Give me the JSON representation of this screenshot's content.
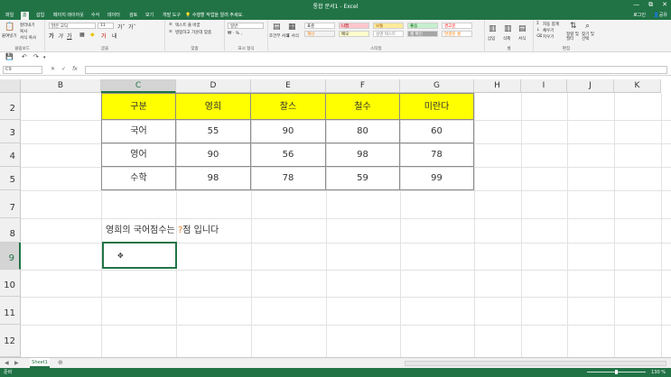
{
  "window": {
    "title": "통합 문서1 - Excel",
    "controls": [
      "—",
      "⧉",
      "✕"
    ]
  },
  "tabs": {
    "items": [
      "파일",
      "홈",
      "삽입",
      "페이지 레이아웃",
      "수식",
      "데이터",
      "검토",
      "보기",
      "개발 도구"
    ],
    "active": "홈",
    "tell_me": "수행할 작업을 알려 주세요.",
    "login": "로그인",
    "share": "공유"
  },
  "ribbon": {
    "clipboard_label": "클립보드",
    "paste": "붙여넣기",
    "cut": "잘라내기",
    "copy": "복사",
    "format_painter": "서식 복사",
    "font_label": "글꼴",
    "font_name": "맑은 고딕",
    "font_size": "11",
    "align_label": "맞춤",
    "wrap_text": "텍스트 줄 바꿈",
    "merge_center": "병합하고 가운데 맞춤",
    "number_label": "표시 형식",
    "number_format": "일반",
    "conditional": "조건부 서식",
    "table_format": "표 서식",
    "styles_label": "스타일",
    "styles": [
      {
        "label": "표준",
        "bg": "#ffffff",
        "color": "#222222"
      },
      {
        "label": "나쁨",
        "bg": "#ffc7ce",
        "color": "#9c0006"
      },
      {
        "label": "보통",
        "bg": "#ffeb9c",
        "color": "#9c5700"
      },
      {
        "label": "좋음",
        "bg": "#c6efce",
        "color": "#006100"
      },
      {
        "label": "경고문",
        "bg": "#ffffff",
        "color": "#ff0000"
      },
      {
        "label": "계산",
        "bg": "#f2f2f2",
        "color": "#fa7d00"
      },
      {
        "label": "메모",
        "bg": "#ffffcc",
        "color": "#222222"
      },
      {
        "label": "설명 텍스트",
        "bg": "#ffffff",
        "color": "#7f7f7f"
      },
      {
        "label": "셀 확인",
        "bg": "#a5a5a5",
        "color": "#ffffff"
      },
      {
        "label": "연결된 셀",
        "bg": "#ffffff",
        "color": "#fa7d00"
      }
    ],
    "cells_label": "셀",
    "insert": "삽입",
    "delete": "삭제",
    "format": "서식",
    "editing_label": "편집",
    "autosum": "자동 합계",
    "fill": "채우기",
    "clear": "지우기",
    "sort_filter": "정렬 및 필터",
    "find_select": "찾기 및 선택"
  },
  "formula_bar": {
    "name_box": "C9",
    "cancel": "✕",
    "enter": "✓",
    "fx": "fx",
    "value": ""
  },
  "grid": {
    "columns": [
      "B",
      "C",
      "D",
      "E",
      "F",
      "G",
      "H",
      "I",
      "J",
      "K"
    ],
    "selected_column": "C",
    "rows": [
      "2",
      "3",
      "4",
      "5",
      "7",
      "8",
      "9",
      "10",
      "11",
      "12"
    ],
    "selected_row": "9"
  },
  "table": {
    "headers": [
      "구분",
      "영희",
      "찰스",
      "철수",
      "미란다"
    ],
    "rows": [
      [
        "국어",
        "55",
        "90",
        "80",
        "60"
      ],
      [
        "영어",
        "90",
        "56",
        "98",
        "78"
      ],
      [
        "수학",
        "98",
        "78",
        "59",
        "99"
      ]
    ],
    "header_color": "#ffff00"
  },
  "sentence": {
    "before": "영희의 국어점수는 ",
    "placeholder": "?",
    "after": "점 입니다"
  },
  "sheets": {
    "names": [
      "Sheet1"
    ],
    "add": "⊕"
  },
  "status": {
    "ready": "준비",
    "zoom": "130 %"
  }
}
